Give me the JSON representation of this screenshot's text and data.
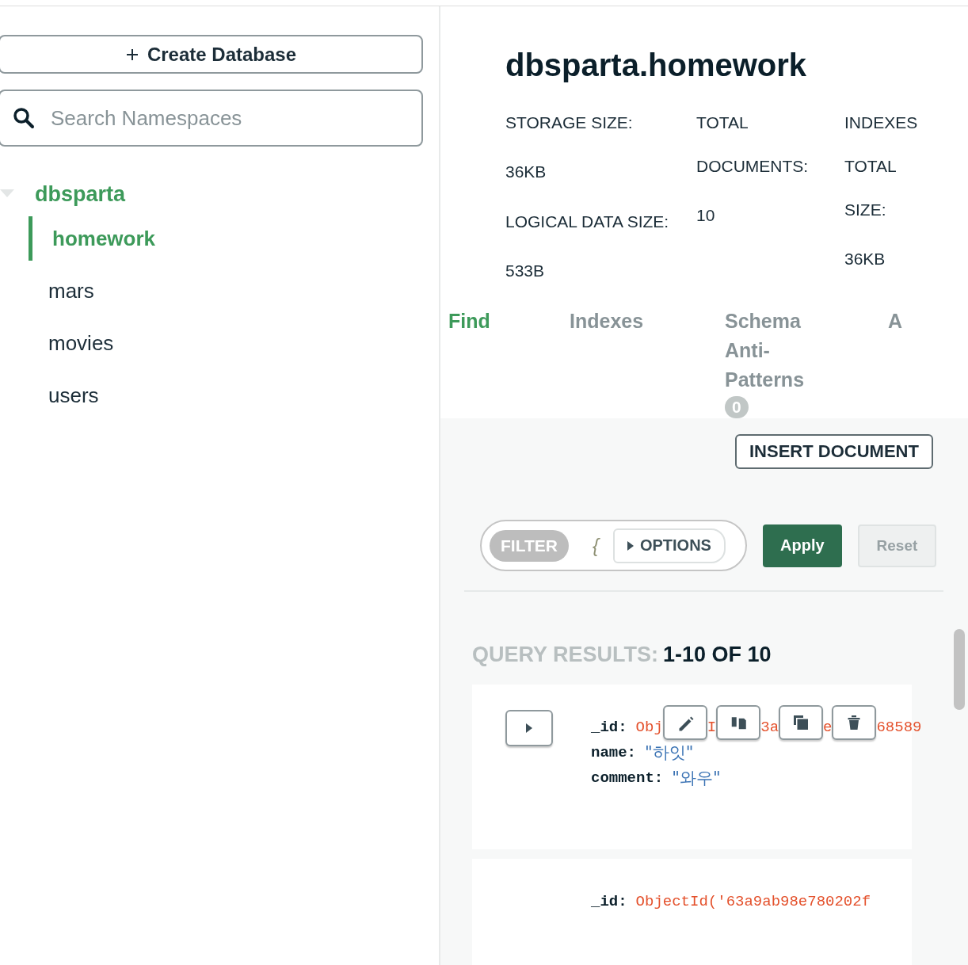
{
  "sidebar": {
    "create_button": "Create Database",
    "search": {
      "placeholder": "Search Namespaces"
    },
    "databases": [
      {
        "name": "dbsparta",
        "expanded": true,
        "children": [
          {
            "name": "homework",
            "selected": true
          },
          {
            "name": "mars",
            "selected": false
          },
          {
            "name": "movies",
            "selected": false
          },
          {
            "name": "users",
            "selected": false
          }
        ]
      }
    ]
  },
  "collection": {
    "title": "dbsparta.homework",
    "stats": [
      {
        "items": [
          {
            "kind": "label",
            "text": "STORAGE SIZE:"
          },
          {
            "kind": "value",
            "text": "36KB"
          },
          {
            "kind": "label",
            "text": "LOGICAL DATA SIZE:"
          },
          {
            "kind": "value",
            "text": "533B"
          }
        ]
      },
      {
        "items": [
          {
            "kind": "label",
            "text": "TOTAL DOCUMENTS:"
          },
          {
            "kind": "value",
            "text": "10"
          }
        ]
      },
      {
        "items": [
          {
            "kind": "label",
            "text": "INDEXES TOTAL SIZE:"
          },
          {
            "kind": "value",
            "text": "36KB"
          }
        ]
      }
    ],
    "tabs": [
      {
        "label": "Find",
        "selected": true
      },
      {
        "label": "Indexes",
        "selected": false
      },
      {
        "label": "Schema Anti-Patterns",
        "selected": false,
        "badge": "0"
      },
      {
        "label": "A",
        "selected": false
      }
    ]
  },
  "toolbar": {
    "insert_button": "INSERT DOCUMENT"
  },
  "query": {
    "filter_label": "FILTER",
    "filter_value": "{",
    "options_button": "OPTIONS",
    "apply_button": "Apply",
    "reset_button": "Reset",
    "reset_disabled": true
  },
  "results": {
    "label": "QUERY RESULTS:",
    "range": "1-10 OF 10",
    "documents": [
      {
        "id_key": "_id:",
        "id_fragments": [
          "Obj",
          "I",
          "3a",
          "e",
          "68589"
        ],
        "actions": [
          {
            "kind": "edit"
          },
          {
            "kind": "copy"
          },
          {
            "kind": "clone"
          },
          {
            "kind": "delete"
          }
        ],
        "fields": [
          {
            "key": "name:",
            "value": "\"하잇\""
          },
          {
            "key": "comment:",
            "value": "\"와우\""
          }
        ]
      },
      {
        "id_key": "_id:",
        "id_fragments": [
          "ObjectId('63a9ab98e780202f"
        ]
      }
    ]
  }
}
